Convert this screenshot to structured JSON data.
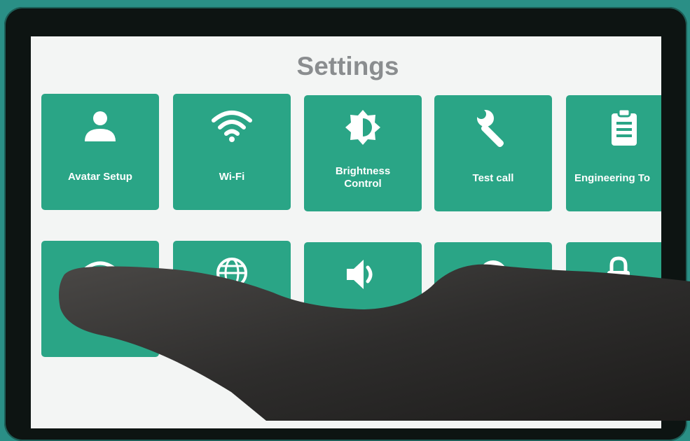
{
  "title": "Settings",
  "accent_color": "#2aa586",
  "tiles": [
    {
      "label": "Avatar Setup",
      "icon": "person-icon"
    },
    {
      "label": "Wi-Fi",
      "icon": "wifi-icon"
    },
    {
      "label": "Brightness\nControl",
      "icon": "brightness-icon"
    },
    {
      "label": "Test call",
      "icon": "wrench-icon"
    },
    {
      "label": "Engineering To",
      "icon": "clipboard-icon"
    },
    {
      "label": "",
      "icon": "wifi-icon"
    },
    {
      "label": "",
      "icon": "globe-icon"
    },
    {
      "label": "",
      "icon": "speaker-icon"
    },
    {
      "label": "",
      "icon": "clock-icon"
    },
    {
      "label": "",
      "icon": "lock-icon"
    }
  ]
}
